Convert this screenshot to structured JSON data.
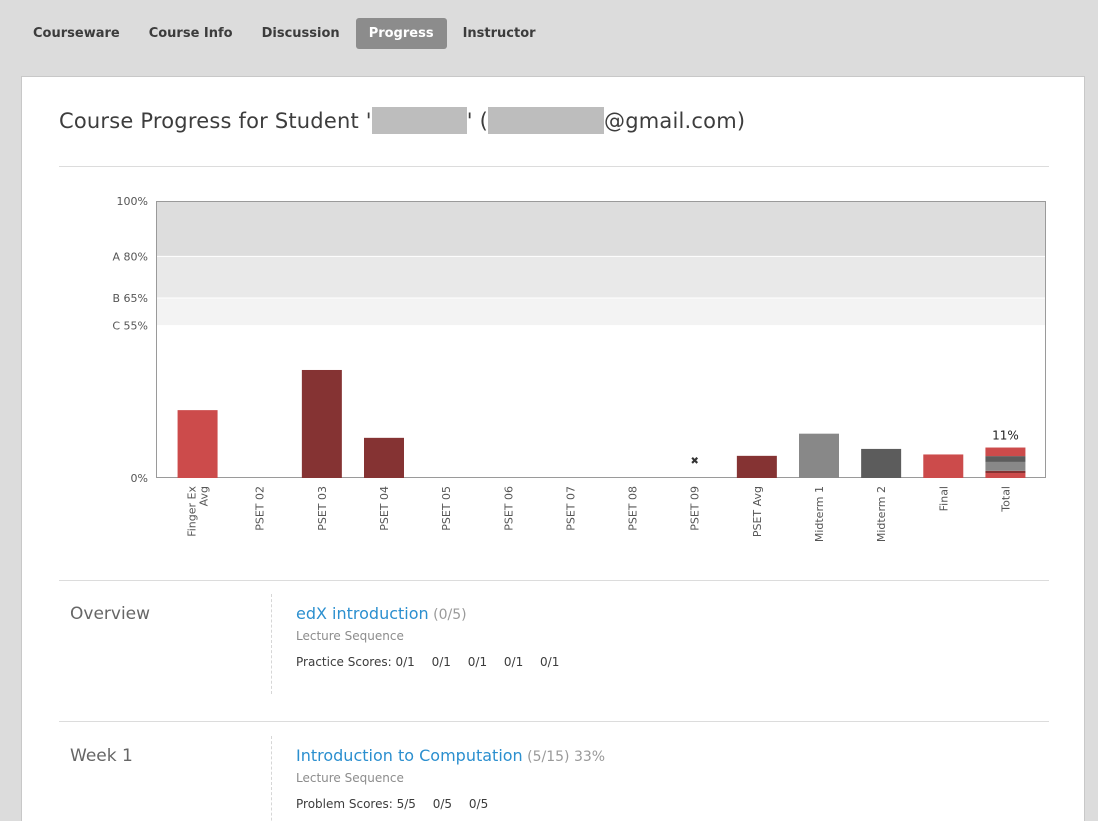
{
  "tabs": [
    {
      "label": "Courseware",
      "active": false
    },
    {
      "label": "Course Info",
      "active": false
    },
    {
      "label": "Discussion",
      "active": false
    },
    {
      "label": "Progress",
      "active": true
    },
    {
      "label": "Instructor",
      "active": false
    }
  ],
  "title": {
    "prefix": "Course Progress for Student '",
    "middle": "' (",
    "suffix": "@gmail.com)"
  },
  "chart_data": {
    "type": "bar",
    "ylim": [
      0,
      100
    ],
    "y_ticks": [
      "100%",
      "A 80%",
      "B 65%",
      "C 55%",
      "0%"
    ],
    "grade_bands": [
      {
        "label": "A",
        "from": 80,
        "to": 100,
        "color": "#dddddd"
      },
      {
        "label": "B",
        "from": 65,
        "to": 80,
        "color": "#e9e9e9"
      },
      {
        "label": "C",
        "from": 55,
        "to": 65,
        "color": "#f3f3f3"
      }
    ],
    "categories": [
      "Finger Ex Avg",
      "PSET 02",
      "PSET 03",
      "PSET 04",
      "PSET 05",
      "PSET 06",
      "PSET 07",
      "PSET 08",
      "PSET 09",
      "PSET Avg",
      "Midterm 1",
      "Midterm 2",
      "Final",
      "Total"
    ],
    "values": [
      24.5,
      0,
      39,
      14.5,
      0,
      0,
      0,
      0,
      0,
      8,
      16,
      10.5,
      8.5,
      11
    ],
    "colors": [
      "#cc4b4b",
      "#cc4b4b",
      "#853333",
      "#853333",
      "#853333",
      "#853333",
      "#853333",
      "#853333",
      "#853333",
      "#853333",
      "#888888",
      "#5c5c5c",
      "#cc4b4b",
      "#cc4b4b"
    ],
    "dropped": [
      "PSET 09"
    ],
    "total_label": "11%",
    "total_segments": [
      {
        "value": 1.8,
        "color": "#cc4b4b"
      },
      {
        "value": 0.8,
        "color": "#853333"
      },
      {
        "value": 3.2,
        "color": "#888888"
      },
      {
        "value": 2.1,
        "color": "#5c5c5c"
      },
      {
        "value": 3.1,
        "color": "#cc4b4b"
      }
    ],
    "label_lines": {
      "Finger Ex Avg": [
        "Finger Ex",
        "Avg"
      ]
    }
  },
  "sections": [
    {
      "title": "Overview",
      "subsections": [
        {
          "name": "edX introduction",
          "score": "(0/5)",
          "percent": "",
          "type": "Lecture Sequence",
          "scores_label": "Practice Scores:",
          "scores": [
            "0/1",
            "0/1",
            "0/1",
            "0/1",
            "0/1"
          ]
        }
      ]
    },
    {
      "title": "Week 1",
      "subsections": [
        {
          "name": "Introduction to Computation",
          "score": "(5/15)",
          "percent": "33%",
          "type": "Lecture Sequence",
          "scores_label": "Problem Scores:",
          "scores": [
            "5/5",
            "0/5",
            "0/5"
          ]
        }
      ]
    }
  ]
}
